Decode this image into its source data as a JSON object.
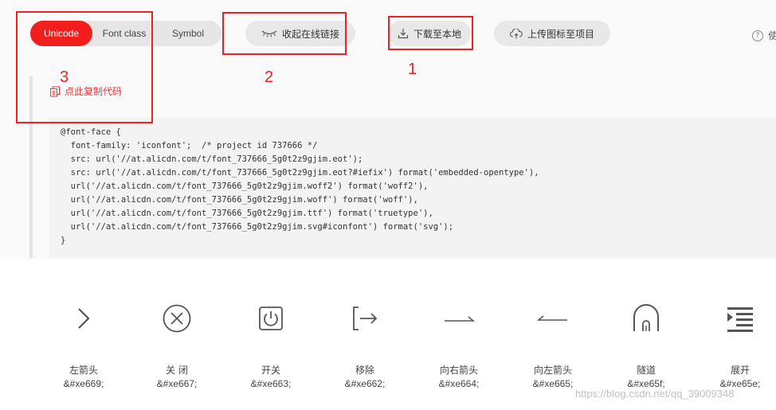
{
  "tabs": [
    {
      "label": "Unicode",
      "active": true
    },
    {
      "label": "Font class",
      "active": false
    },
    {
      "label": "Symbol",
      "active": false
    }
  ],
  "toolbar": {
    "collapse_label": "收起在线链接",
    "download_label": "下载至本地",
    "upload_label": "上传图标至项目",
    "help_label": "使"
  },
  "annotations": {
    "m1": "1",
    "m2": "2",
    "m3": "3"
  },
  "copy_label": "点此复制代码",
  "code_text": "@font-face {\n  font-family: 'iconfont';  /* project id 737666 */\n  src: url('//at.alicdn.com/t/font_737666_5g0t2z9gjim.eot');\n  src: url('//at.alicdn.com/t/font_737666_5g0t2z9gjim.eot?#iefix') format('embedded-opentype'),\n  url('//at.alicdn.com/t/font_737666_5g0t2z9gjim.woff2') format('woff2'),\n  url('//at.alicdn.com/t/font_737666_5g0t2z9gjim.woff') format('woff'),\n  url('//at.alicdn.com/t/font_737666_5g0t2z9gjim.ttf') format('truetype'),\n  url('//at.alicdn.com/t/font_737666_5g0t2z9gjim.svg#iconfont') format('svg');\n}",
  "icons": [
    {
      "name": "左箭头",
      "code": "&#xe669;",
      "icon": "chevron-right-icon"
    },
    {
      "name": "关 闭",
      "code": "&#xe667;",
      "icon": "close-circle-icon"
    },
    {
      "name": "开关",
      "code": "&#xe663;",
      "icon": "power-icon"
    },
    {
      "name": "移除",
      "code": "&#xe662;",
      "icon": "logout-icon"
    },
    {
      "name": "向右箭头",
      "code": "&#xe664;",
      "icon": "arrow-right-line-icon"
    },
    {
      "name": "向左箭头",
      "code": "&#xe665;",
      "icon": "arrow-left-line-icon"
    },
    {
      "name": "隧道",
      "code": "&#xe65f;",
      "icon": "tunnel-icon"
    },
    {
      "name": "展开",
      "code": "&#xe65e;",
      "icon": "indent-icon"
    }
  ],
  "watermark": "https://blog.csdn.net/qq_39009348",
  "colors": {
    "accent": "#f21e1e",
    "annotation": "#ee2222",
    "pill_bg": "#e8e8e8"
  }
}
